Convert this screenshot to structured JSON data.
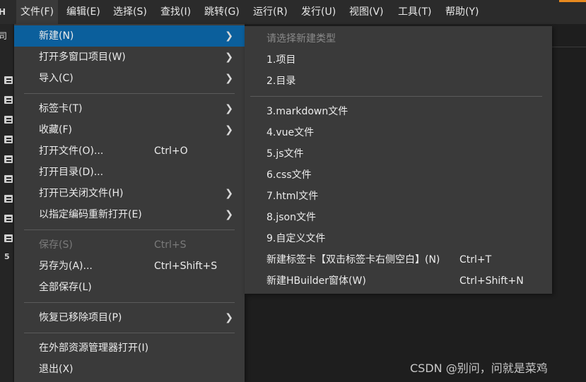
{
  "menubar": {
    "items": [
      {
        "label": "文件(F)"
      },
      {
        "label": "编辑(E)"
      },
      {
        "label": "选择(S)"
      },
      {
        "label": "查找(I)"
      },
      {
        "label": "跳转(G)"
      },
      {
        "label": "运行(R)"
      },
      {
        "label": "发行(U)"
      },
      {
        "label": "视图(V)"
      },
      {
        "label": "工具(T)"
      },
      {
        "label": "帮助(Y)"
      }
    ],
    "app_icon": "H",
    "accent_color": "#e88a1f"
  },
  "left_strip": {
    "top_glyph": "司",
    "last_icon_label": "5"
  },
  "file_menu": {
    "highlight_color": "#0b5f9c",
    "items": [
      {
        "label": "新建(N)",
        "shortcut": "",
        "arrow": "❯"
      },
      {
        "label": "打开多窗口项目(W)",
        "shortcut": "",
        "arrow": "❯"
      },
      {
        "label": "导入(C)",
        "shortcut": "",
        "arrow": "❯"
      },
      {
        "label": "标签卡(T)",
        "shortcut": "",
        "arrow": "❯"
      },
      {
        "label": "收藏(F)",
        "shortcut": "",
        "arrow": "❯"
      },
      {
        "label": "打开文件(O)...",
        "shortcut": "Ctrl+O"
      },
      {
        "label": "打开目录(D)..."
      },
      {
        "label": "打开已关闭文件(H)",
        "arrow": "❯"
      },
      {
        "label": "以指定编码重新打开(E)",
        "arrow": "❯"
      },
      {
        "label": "保存(S)",
        "shortcut": "Ctrl+S"
      },
      {
        "label": "另存为(A)...",
        "shortcut": "Ctrl+Shift+S"
      },
      {
        "label": "全部保存(L)"
      },
      {
        "label": "恢复已移除项目(P)",
        "arrow": "❯"
      },
      {
        "label": "在外部资源管理器打开(I)"
      },
      {
        "label": "退出(X)"
      }
    ]
  },
  "submenu": {
    "header": "请选择新建类型",
    "items": [
      {
        "label": "1.项目"
      },
      {
        "label": "2.目录"
      },
      {
        "label": "3.markdown文件"
      },
      {
        "label": "4.vue文件"
      },
      {
        "label": "5.js文件"
      },
      {
        "label": "6.css文件"
      },
      {
        "label": "7.html文件"
      },
      {
        "label": "8.json文件"
      },
      {
        "label": "9.自定义文件"
      },
      {
        "label": "新建标签卡【双击标签卡右侧空白】(N)",
        "shortcut": "Ctrl+T"
      },
      {
        "label": "新建HBuilder窗体(W)",
        "shortcut": "Ctrl+Shift+N"
      }
    ]
  },
  "watermark": "CSDN @别问，问就是菜鸡"
}
